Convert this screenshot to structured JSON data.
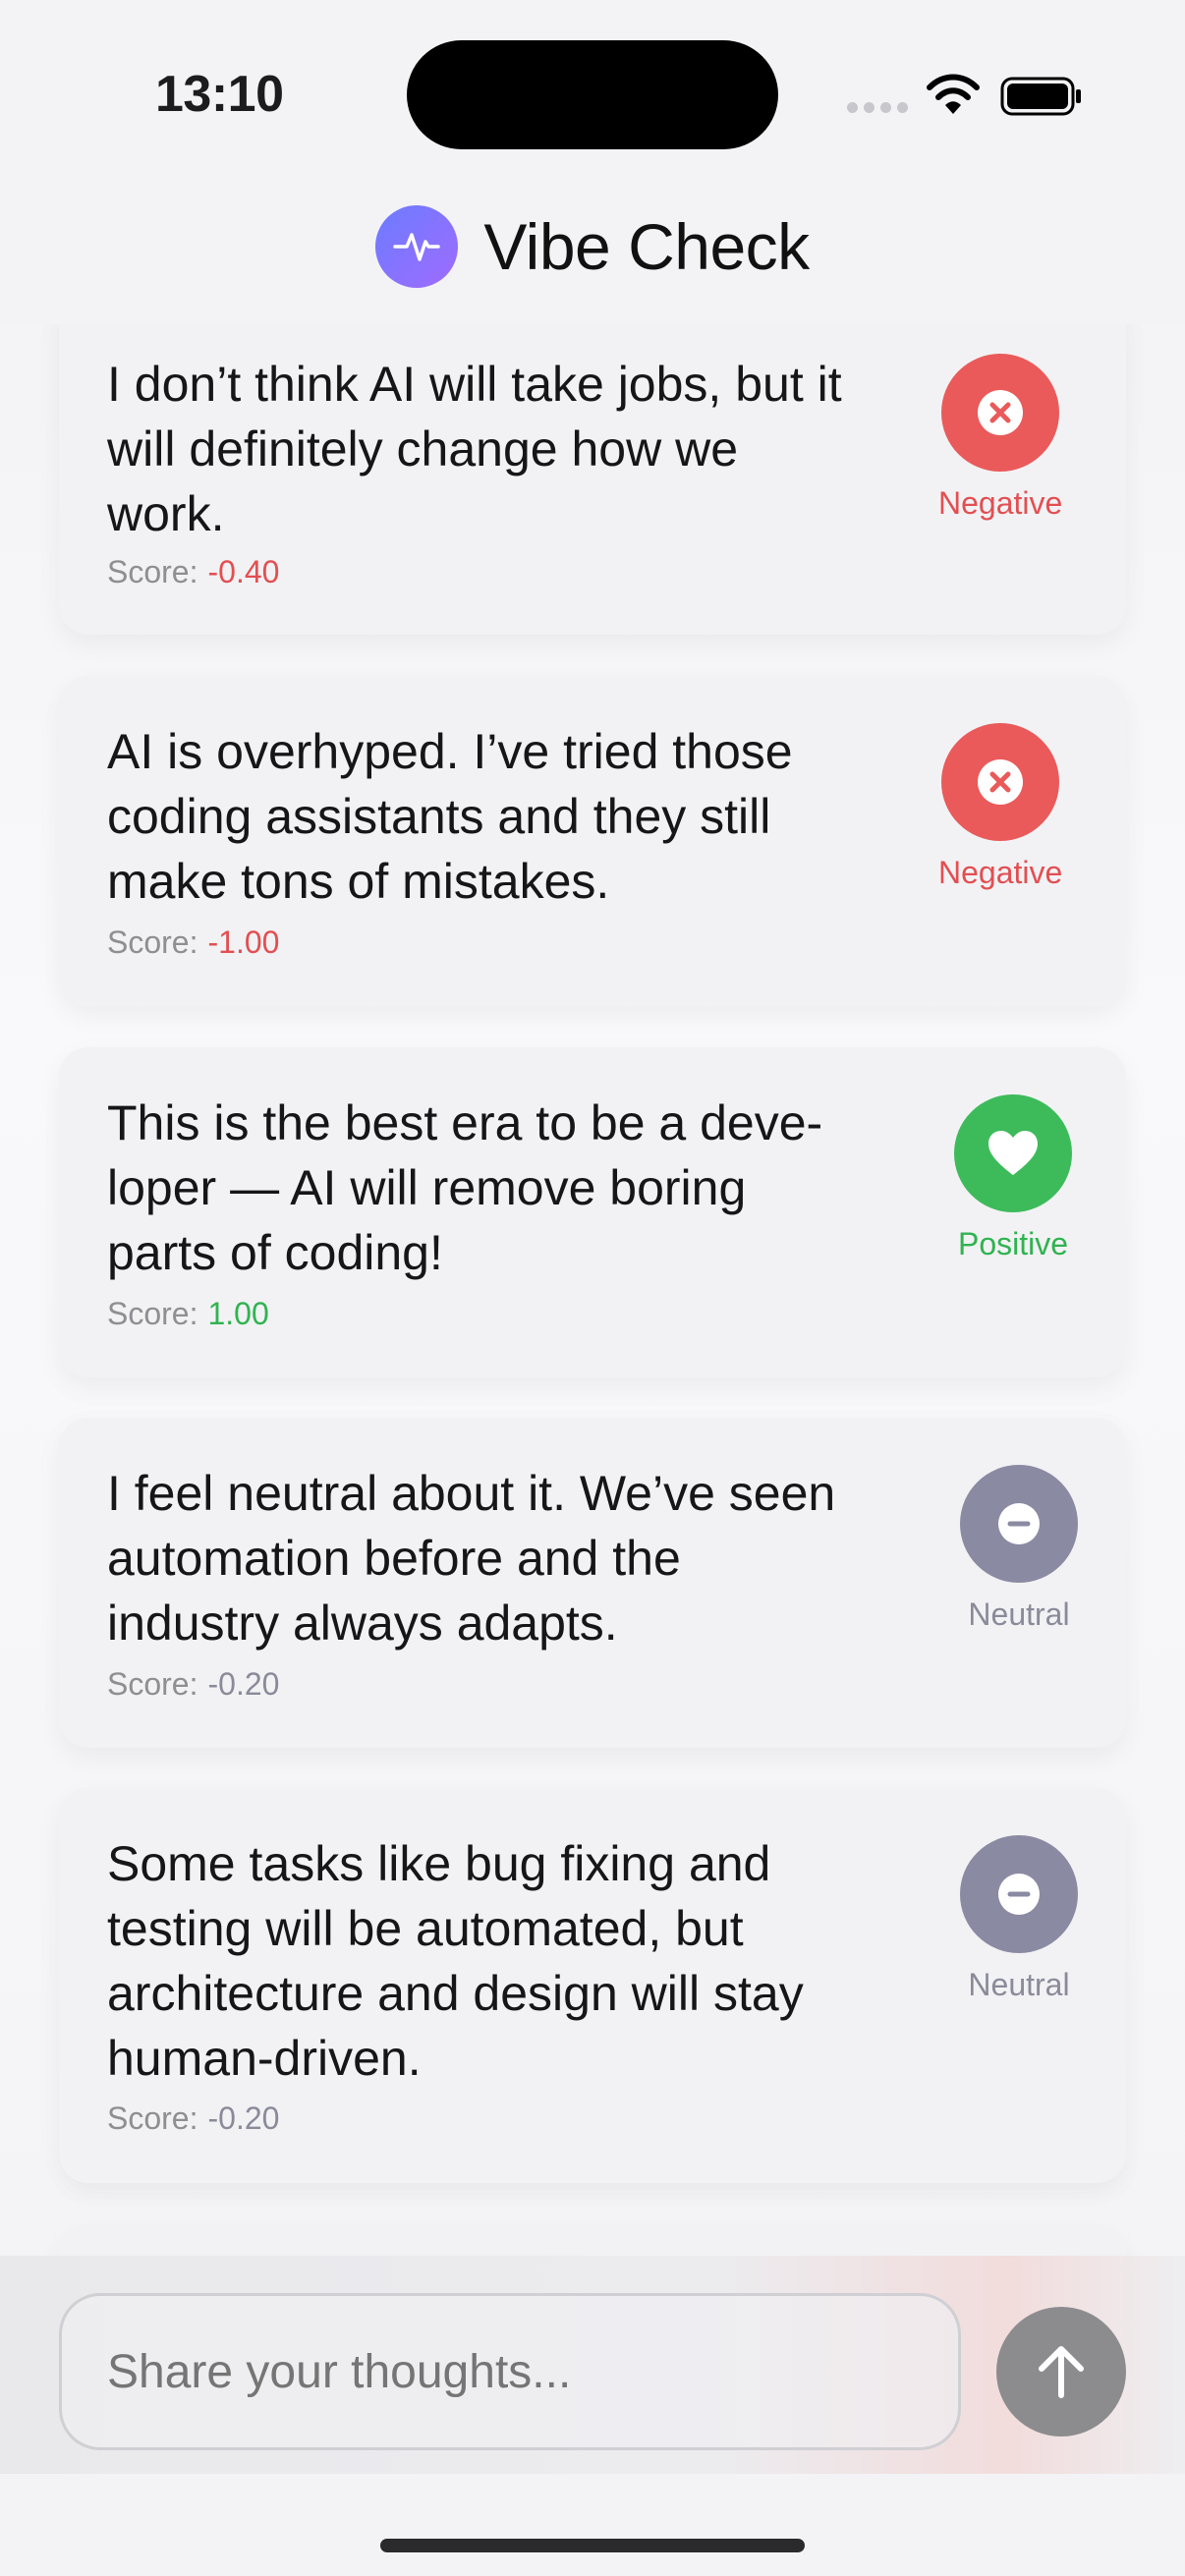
{
  "status_bar": {
    "time": "13:10"
  },
  "header": {
    "title": "Vibe Check",
    "logo_icon": "pulse-icon"
  },
  "score_label": "Score:",
  "posts": [
    {
      "text": "I don’t think AI will take jobs, but it will definitely change how we work.",
      "score": "-0.40",
      "sentiment": "Negative",
      "icon": "x-circle-icon"
    },
    {
      "text": "AI is overhyped. I’ve tried those coding assistants and they still make tons of mistakes.",
      "score": "-1.00",
      "sentiment": "Negative",
      "icon": "x-circle-icon"
    },
    {
      "text": "This is the best era to be a deve-loper — AI will remove boring parts of coding!",
      "score": "1.00",
      "sentiment": "Positive",
      "icon": "heart-icon"
    },
    {
      "text": "I feel neutral about it. We’ve seen automation before and the industry always adapts.",
      "score": "-0.20",
      "sentiment": "Neutral",
      "icon": "minus-circle-icon"
    },
    {
      "text": "Some tasks like bug fixing and testing will be automated, but architecture and design will stay human-driven.",
      "score": "-0.20",
      "sentiment": "Neutral",
      "icon": "minus-circle-icon"
    }
  ],
  "composer": {
    "placeholder": "Share your thoughts...",
    "send_icon": "arrow-up-icon"
  },
  "colors": {
    "negative": "#e24f52",
    "positive": "#30b350",
    "neutral": "#8a8a9a",
    "brand_start": "#6b7cff",
    "brand_end": "#a06bff"
  }
}
